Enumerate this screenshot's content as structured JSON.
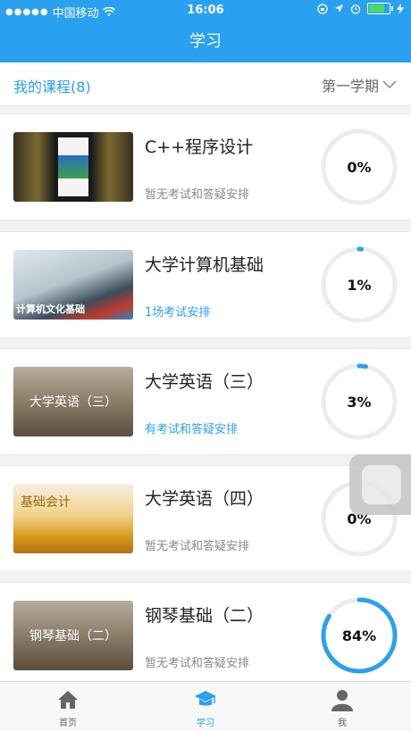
{
  "status_bar": {
    "carrier": "中国移动",
    "time": "16:06"
  },
  "nav": {
    "title": "学习"
  },
  "header": {
    "my_courses": "我的课程(8)",
    "semester": "第一学期"
  },
  "courses": [
    {
      "title": "C++程序设计",
      "subtitle": "暂无考试和答疑安排",
      "subtitle_blue": false,
      "progress_label": "0%",
      "progress": 0,
      "thumb_label": "",
      "thumb_style": "cpp"
    },
    {
      "title": "大学计算机基础",
      "subtitle": "1场考试安排",
      "subtitle_blue": true,
      "progress_label": "1%",
      "progress": 0.01,
      "thumb_label": "计算机文化基础",
      "thumb_style": "laptop"
    },
    {
      "title": "大学英语（三）",
      "subtitle": "有考试和答疑安排",
      "subtitle_blue": true,
      "progress_label": "3%",
      "progress": 0.03,
      "thumb_label": "大学英语（三）",
      "thumb_style": "brown"
    },
    {
      "title": "大学英语（四）",
      "subtitle": "暂无考试和答疑安排",
      "subtitle_blue": false,
      "progress_label": "0%",
      "progress": 0,
      "thumb_label": "基础会计",
      "thumb_style": "gold"
    },
    {
      "title": "钢琴基础（二）",
      "subtitle": "暂无考试和答疑安排",
      "subtitle_blue": false,
      "progress_label": "84%",
      "progress": 0.84,
      "thumb_label": "钢琴基础（二）",
      "thumb_style": "brown"
    }
  ],
  "tabs": [
    {
      "label": "首页",
      "icon": "home-icon",
      "active": false
    },
    {
      "label": "学习",
      "icon": "graduation-cap-icon",
      "active": true
    },
    {
      "label": "我",
      "icon": "user-icon",
      "active": false
    }
  ],
  "colors": {
    "accent": "#2aa0f0",
    "ring_track": "#ececf0"
  }
}
